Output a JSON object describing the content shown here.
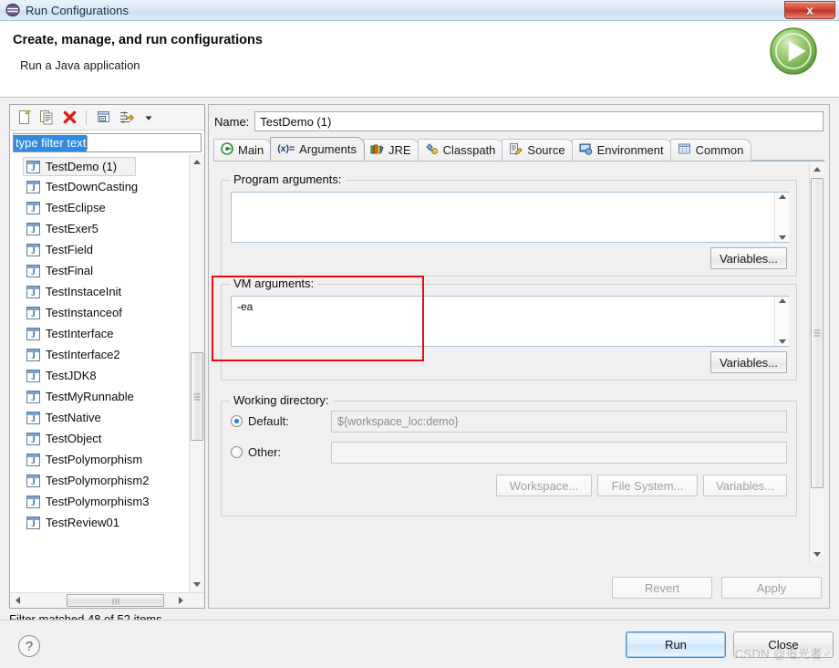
{
  "window": {
    "title": "Run Configurations",
    "close_label": "x",
    "app_icon": "eclipse-icon"
  },
  "banner": {
    "title": "Create, manage, and run configurations",
    "subtitle": "Run a Java application",
    "icon": "run-green-play-icon"
  },
  "left": {
    "toolbar": [
      {
        "name": "new-configuration-icon",
        "tip": "New launch configuration"
      },
      {
        "name": "duplicate-icon",
        "tip": "Duplicate"
      },
      {
        "name": "delete-icon",
        "tip": "Delete"
      },
      {
        "name": "collapse-all-icon",
        "tip": "Collapse All"
      },
      {
        "name": "filter-icon",
        "tip": "Filter"
      },
      {
        "name": "chevron-down-icon",
        "tip": "Menu"
      }
    ],
    "filter": {
      "value": "type filter text",
      "placeholder": "type filter text",
      "selected": true
    },
    "tree_items": [
      {
        "label": "TestDemo (1)",
        "selected": true
      },
      {
        "label": "TestDownCasting",
        "selected": false
      },
      {
        "label": "TestEclipse",
        "selected": false
      },
      {
        "label": "TestExer5",
        "selected": false
      },
      {
        "label": "TestField",
        "selected": false
      },
      {
        "label": "TestFinal",
        "selected": false
      },
      {
        "label": "TestInstaceInit",
        "selected": false
      },
      {
        "label": "TestInstanceof",
        "selected": false
      },
      {
        "label": "TestInterface",
        "selected": false
      },
      {
        "label": "TestInterface2",
        "selected": false
      },
      {
        "label": "TestJDK8",
        "selected": false
      },
      {
        "label": "TestMyRunnable",
        "selected": false
      },
      {
        "label": "TestNative",
        "selected": false
      },
      {
        "label": "TestObject",
        "selected": false
      },
      {
        "label": "TestPolymorphism",
        "selected": false
      },
      {
        "label": "TestPolymorphism2",
        "selected": false
      },
      {
        "label": "TestPolymorphism3",
        "selected": false
      },
      {
        "label": "TestReview01",
        "selected": false
      }
    ],
    "status": "Filter matched 48 of 52 items"
  },
  "right": {
    "name_label": "Name:",
    "name_value": "TestDemo (1)",
    "tabs": [
      {
        "label": "Main",
        "icon": "main-green-circle-icon",
        "active": false
      },
      {
        "label": "Arguments",
        "icon": "arguments-variable-icon",
        "active": true
      },
      {
        "label": "JRE",
        "icon": "jre-books-icon",
        "active": false
      },
      {
        "label": "Classpath",
        "icon": "classpath-icon",
        "active": false
      },
      {
        "label": "Source",
        "icon": "source-pencil-icon",
        "active": false
      },
      {
        "label": "Environment",
        "icon": "environment-icon",
        "active": false
      },
      {
        "label": "Common",
        "icon": "common-grid-icon",
        "active": false
      }
    ],
    "program_arguments": {
      "legend": "Program arguments:",
      "value": "",
      "variables_button": "Variables..."
    },
    "vm_arguments": {
      "legend": "VM arguments:",
      "value": "-ea",
      "variables_button": "Variables...",
      "highlight_color": "#e30b16"
    },
    "working_directory": {
      "legend": "Working directory:",
      "default_label": "Default:",
      "default_selected": true,
      "default_value": "${workspace_loc:demo}",
      "other_label": "Other:",
      "other_selected": false,
      "other_value": "",
      "workspace_button": "Workspace...",
      "file_system_button": "File System...",
      "variables_button": "Variables..."
    },
    "revert_button": "Revert",
    "apply_button": "Apply",
    "revert_enabled": false,
    "apply_enabled": false
  },
  "footer": {
    "help_label": "?",
    "run_button": "Run",
    "close_button": "Close",
    "watermark": "CSDN @追光者♂"
  }
}
